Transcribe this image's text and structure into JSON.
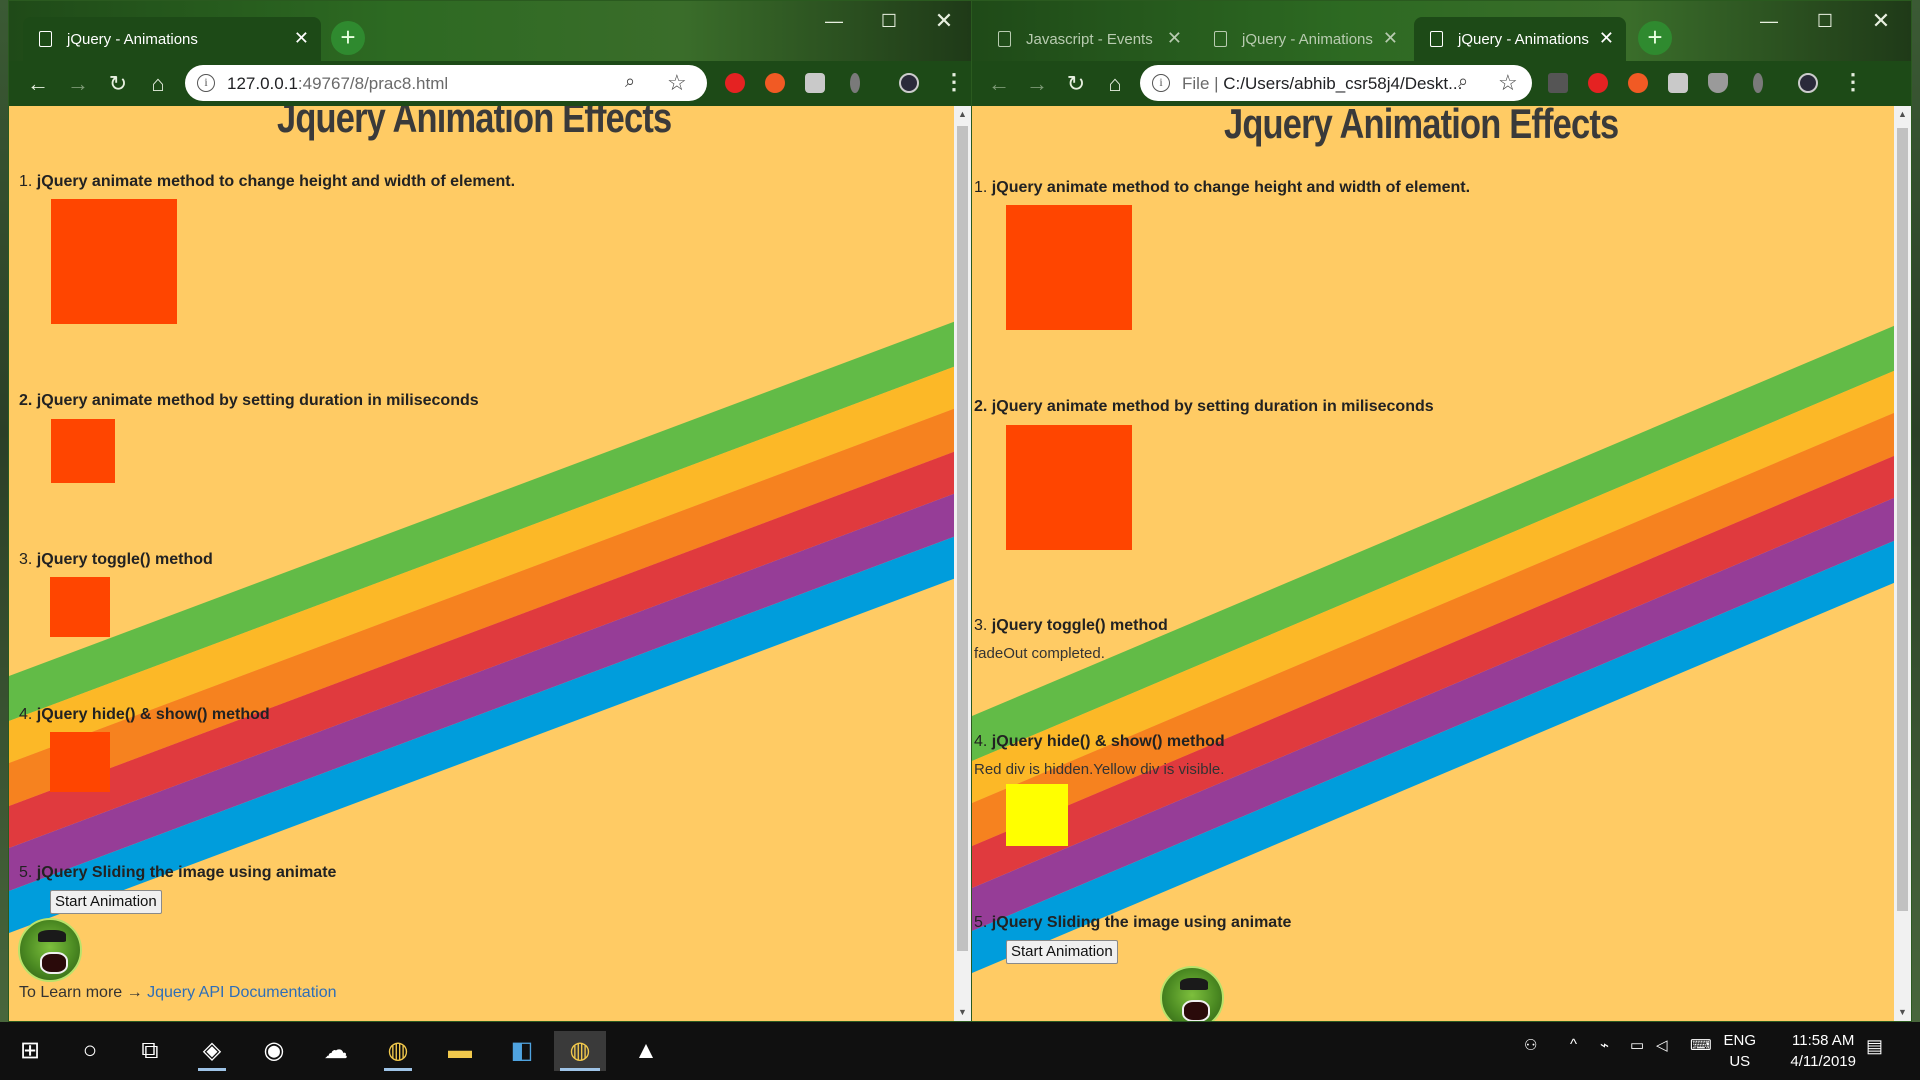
{
  "left_window": {
    "tab_title": "jQuery - Animations",
    "url_host": "127.0.0.1",
    "url_rest": ":49767/8/prac8.html",
    "page_title": "Jquery Animation Effects",
    "items": [
      {
        "num": "1.",
        "label": "jQuery animate method to change height and width of element."
      },
      {
        "num": "2.",
        "label": "jQuery animate method by setting duration in miliseconds"
      },
      {
        "num": "3.",
        "label": "jQuery toggle() method"
      },
      {
        "num": "4.",
        "label": "jQuery hide() & show() method"
      },
      {
        "num": "5.",
        "label": "jQuery Sliding the image using animate"
      }
    ],
    "button_label": "Start Animation",
    "footer_prefix": "To Learn more → ",
    "footer_link": "Jquery API Documentation"
  },
  "right_window": {
    "tabs": [
      "Javascript - Events",
      "jQuery - Animations",
      "jQuery - Animations"
    ],
    "url_scheme": "File",
    "url_path": "C:/Users/abhib_csr58j4/Deskt...",
    "page_title": "Jquery Animation Effects",
    "items": [
      {
        "num": "1.",
        "label": "jQuery animate method to change height and width of element."
      },
      {
        "num": "2.",
        "label": "jQuery animate method by setting duration in miliseconds"
      },
      {
        "num": "3.",
        "label": "jQuery toggle() method"
      },
      {
        "num": "4.",
        "label": "jQuery hide() & show() method"
      },
      {
        "num": "5.",
        "label": "jQuery Sliding the image using animate"
      }
    ],
    "toggle_note": "fadeOut completed.",
    "hide_show_note": "Red div is hidden.Yellow div is visible.",
    "button_label": "Start Animation"
  },
  "taskbar": {
    "lang_line1": "ENG",
    "lang_line2": "US",
    "time": "11:58 AM",
    "date": "4/11/2019"
  },
  "colors": {
    "page_bg": "#ffcb64",
    "box_red": "#ff4500",
    "box_yellow": "#ffff00",
    "rainbow": [
      "#62bb47",
      "#fcb827",
      "#f6821f",
      "#e03a3e",
      "#963d97",
      "#009ddc"
    ],
    "link": "#2e6eb8"
  }
}
